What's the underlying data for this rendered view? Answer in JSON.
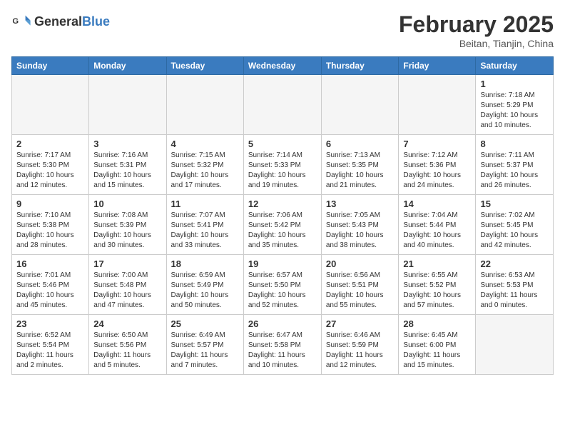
{
  "header": {
    "logo": {
      "general": "General",
      "blue": "Blue"
    },
    "month_year": "February 2025",
    "location": "Beitan, Tianjin, China"
  },
  "days_of_week": [
    "Sunday",
    "Monday",
    "Tuesday",
    "Wednesday",
    "Thursday",
    "Friday",
    "Saturday"
  ],
  "weeks": [
    [
      {
        "day": "",
        "empty": true
      },
      {
        "day": "",
        "empty": true
      },
      {
        "day": "",
        "empty": true
      },
      {
        "day": "",
        "empty": true
      },
      {
        "day": "",
        "empty": true
      },
      {
        "day": "",
        "empty": true
      },
      {
        "day": "1",
        "detail": "Sunrise: 7:18 AM\nSunset: 5:29 PM\nDaylight: 10 hours and 10 minutes."
      }
    ],
    [
      {
        "day": "2",
        "detail": "Sunrise: 7:17 AM\nSunset: 5:30 PM\nDaylight: 10 hours and 12 minutes."
      },
      {
        "day": "3",
        "detail": "Sunrise: 7:16 AM\nSunset: 5:31 PM\nDaylight: 10 hours and 15 minutes."
      },
      {
        "day": "4",
        "detail": "Sunrise: 7:15 AM\nSunset: 5:32 PM\nDaylight: 10 hours and 17 minutes."
      },
      {
        "day": "5",
        "detail": "Sunrise: 7:14 AM\nSunset: 5:33 PM\nDaylight: 10 hours and 19 minutes."
      },
      {
        "day": "6",
        "detail": "Sunrise: 7:13 AM\nSunset: 5:35 PM\nDaylight: 10 hours and 21 minutes."
      },
      {
        "day": "7",
        "detail": "Sunrise: 7:12 AM\nSunset: 5:36 PM\nDaylight: 10 hours and 24 minutes."
      },
      {
        "day": "8",
        "detail": "Sunrise: 7:11 AM\nSunset: 5:37 PM\nDaylight: 10 hours and 26 minutes."
      }
    ],
    [
      {
        "day": "9",
        "detail": "Sunrise: 7:10 AM\nSunset: 5:38 PM\nDaylight: 10 hours and 28 minutes."
      },
      {
        "day": "10",
        "detail": "Sunrise: 7:08 AM\nSunset: 5:39 PM\nDaylight: 10 hours and 30 minutes."
      },
      {
        "day": "11",
        "detail": "Sunrise: 7:07 AM\nSunset: 5:41 PM\nDaylight: 10 hours and 33 minutes."
      },
      {
        "day": "12",
        "detail": "Sunrise: 7:06 AM\nSunset: 5:42 PM\nDaylight: 10 hours and 35 minutes."
      },
      {
        "day": "13",
        "detail": "Sunrise: 7:05 AM\nSunset: 5:43 PM\nDaylight: 10 hours and 38 minutes."
      },
      {
        "day": "14",
        "detail": "Sunrise: 7:04 AM\nSunset: 5:44 PM\nDaylight: 10 hours and 40 minutes."
      },
      {
        "day": "15",
        "detail": "Sunrise: 7:02 AM\nSunset: 5:45 PM\nDaylight: 10 hours and 42 minutes."
      }
    ],
    [
      {
        "day": "16",
        "detail": "Sunrise: 7:01 AM\nSunset: 5:46 PM\nDaylight: 10 hours and 45 minutes."
      },
      {
        "day": "17",
        "detail": "Sunrise: 7:00 AM\nSunset: 5:48 PM\nDaylight: 10 hours and 47 minutes."
      },
      {
        "day": "18",
        "detail": "Sunrise: 6:59 AM\nSunset: 5:49 PM\nDaylight: 10 hours and 50 minutes."
      },
      {
        "day": "19",
        "detail": "Sunrise: 6:57 AM\nSunset: 5:50 PM\nDaylight: 10 hours and 52 minutes."
      },
      {
        "day": "20",
        "detail": "Sunrise: 6:56 AM\nSunset: 5:51 PM\nDaylight: 10 hours and 55 minutes."
      },
      {
        "day": "21",
        "detail": "Sunrise: 6:55 AM\nSunset: 5:52 PM\nDaylight: 10 hours and 57 minutes."
      },
      {
        "day": "22",
        "detail": "Sunrise: 6:53 AM\nSunset: 5:53 PM\nDaylight: 11 hours and 0 minutes."
      }
    ],
    [
      {
        "day": "23",
        "detail": "Sunrise: 6:52 AM\nSunset: 5:54 PM\nDaylight: 11 hours and 2 minutes."
      },
      {
        "day": "24",
        "detail": "Sunrise: 6:50 AM\nSunset: 5:56 PM\nDaylight: 11 hours and 5 minutes."
      },
      {
        "day": "25",
        "detail": "Sunrise: 6:49 AM\nSunset: 5:57 PM\nDaylight: 11 hours and 7 minutes."
      },
      {
        "day": "26",
        "detail": "Sunrise: 6:47 AM\nSunset: 5:58 PM\nDaylight: 11 hours and 10 minutes."
      },
      {
        "day": "27",
        "detail": "Sunrise: 6:46 AM\nSunset: 5:59 PM\nDaylight: 11 hours and 12 minutes."
      },
      {
        "day": "28",
        "detail": "Sunrise: 6:45 AM\nSunset: 6:00 PM\nDaylight: 11 hours and 15 minutes."
      },
      {
        "day": "",
        "empty": true
      }
    ]
  ]
}
